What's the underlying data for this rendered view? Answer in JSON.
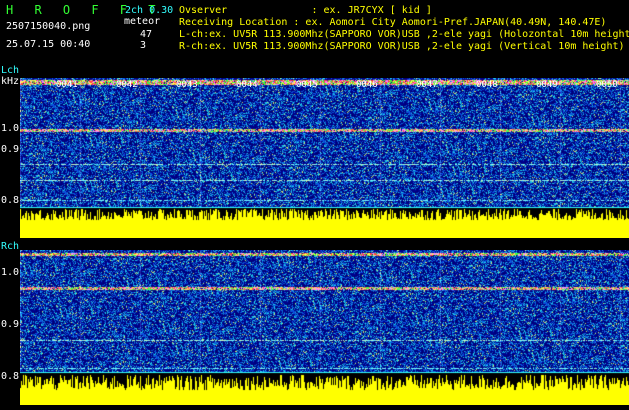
{
  "header": {
    "app_title": "H R O F F T",
    "version": "2ch 0.30",
    "file_name": "2507150040.png",
    "mode_label": "meteor",
    "datetime": "25.07.15 00:40",
    "count_l": "47",
    "count_r": "3",
    "observer_line": "Ovserver              : ex. JR7CYX [ kid ]",
    "location_line": "Receiving Location : ex. Aomori City Aomori-Pref.JAPAN(40.49N, 140.47E)",
    "lch_line": "L-ch:ex. UV5R 113.900Mhz(SAPPORO VOR)USB ,2-ele yagi (Holozontal 10m height)",
    "rch_line": "R-ch:ex. UV5R 113.900Mhz(SAPPORO VOR)USB ,2-ele yagi (Vertical 10m height)"
  },
  "lch": {
    "label": "Lch",
    "unit": "kHz",
    "y_ticks": [
      "1.0",
      "0.9",
      "0.8"
    ],
    "time_ticks": [
      "0041",
      "0042",
      "0043",
      "0044",
      "0045",
      "0046",
      "0047",
      "0048",
      "0049",
      "0050"
    ]
  },
  "rch": {
    "label": "Rch",
    "y_ticks": [
      "1.0",
      "0.9",
      "0.8"
    ]
  },
  "colors": {
    "background": "#000000",
    "header_text": "#ffffff",
    "title_green": "#33ff33",
    "label_cyan": "#33ffff",
    "level_yellow": "#ffff00",
    "spectrum_dark": "#00007a",
    "spectrum_mid": "#1060c0"
  }
}
